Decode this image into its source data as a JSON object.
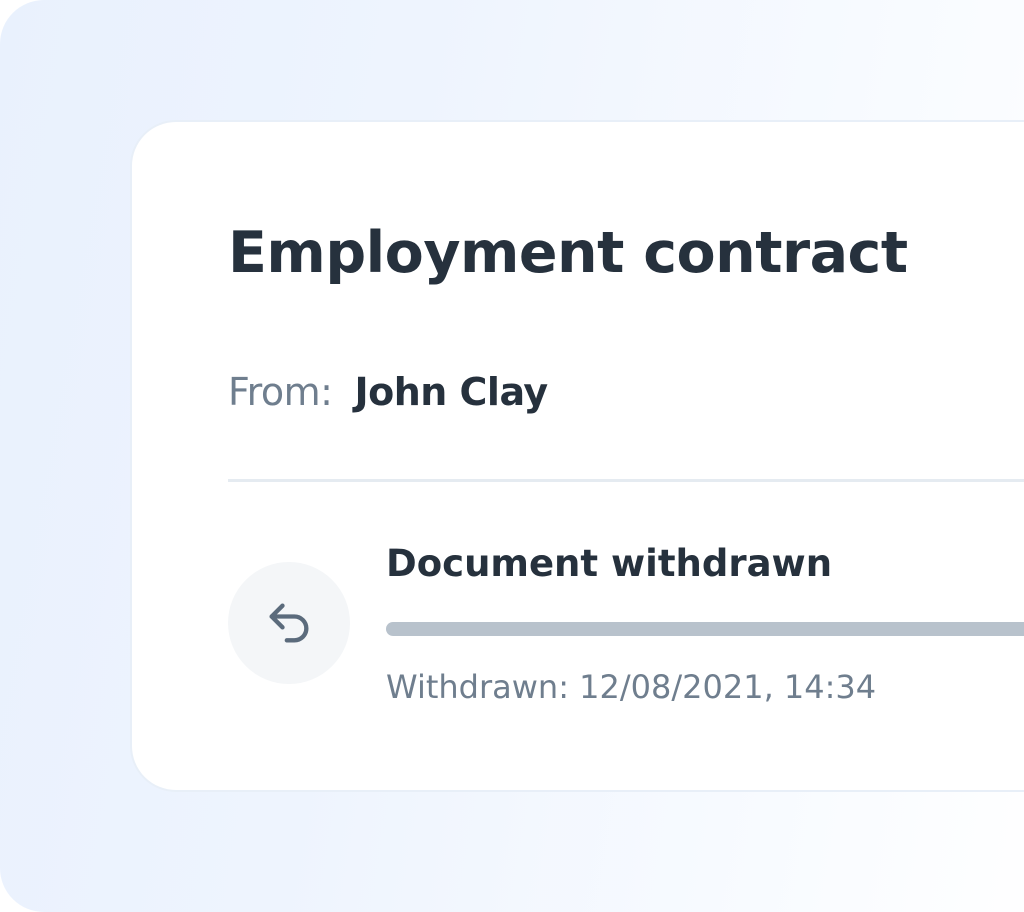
{
  "document": {
    "title": "Employment contract",
    "from_label": "From:",
    "from_name": "John Clay"
  },
  "status": {
    "icon": "undo-arrow-icon",
    "title": "Document withdrawn",
    "time_text": "Withdrawn: 12/08/2021, 14:34"
  },
  "colors": {
    "text_primary": "#26313d",
    "text_secondary": "#6f7e8e",
    "progress_bar": "#b8c2cc",
    "icon_background": "#f4f6f8",
    "backdrop": "#eef4fe"
  }
}
